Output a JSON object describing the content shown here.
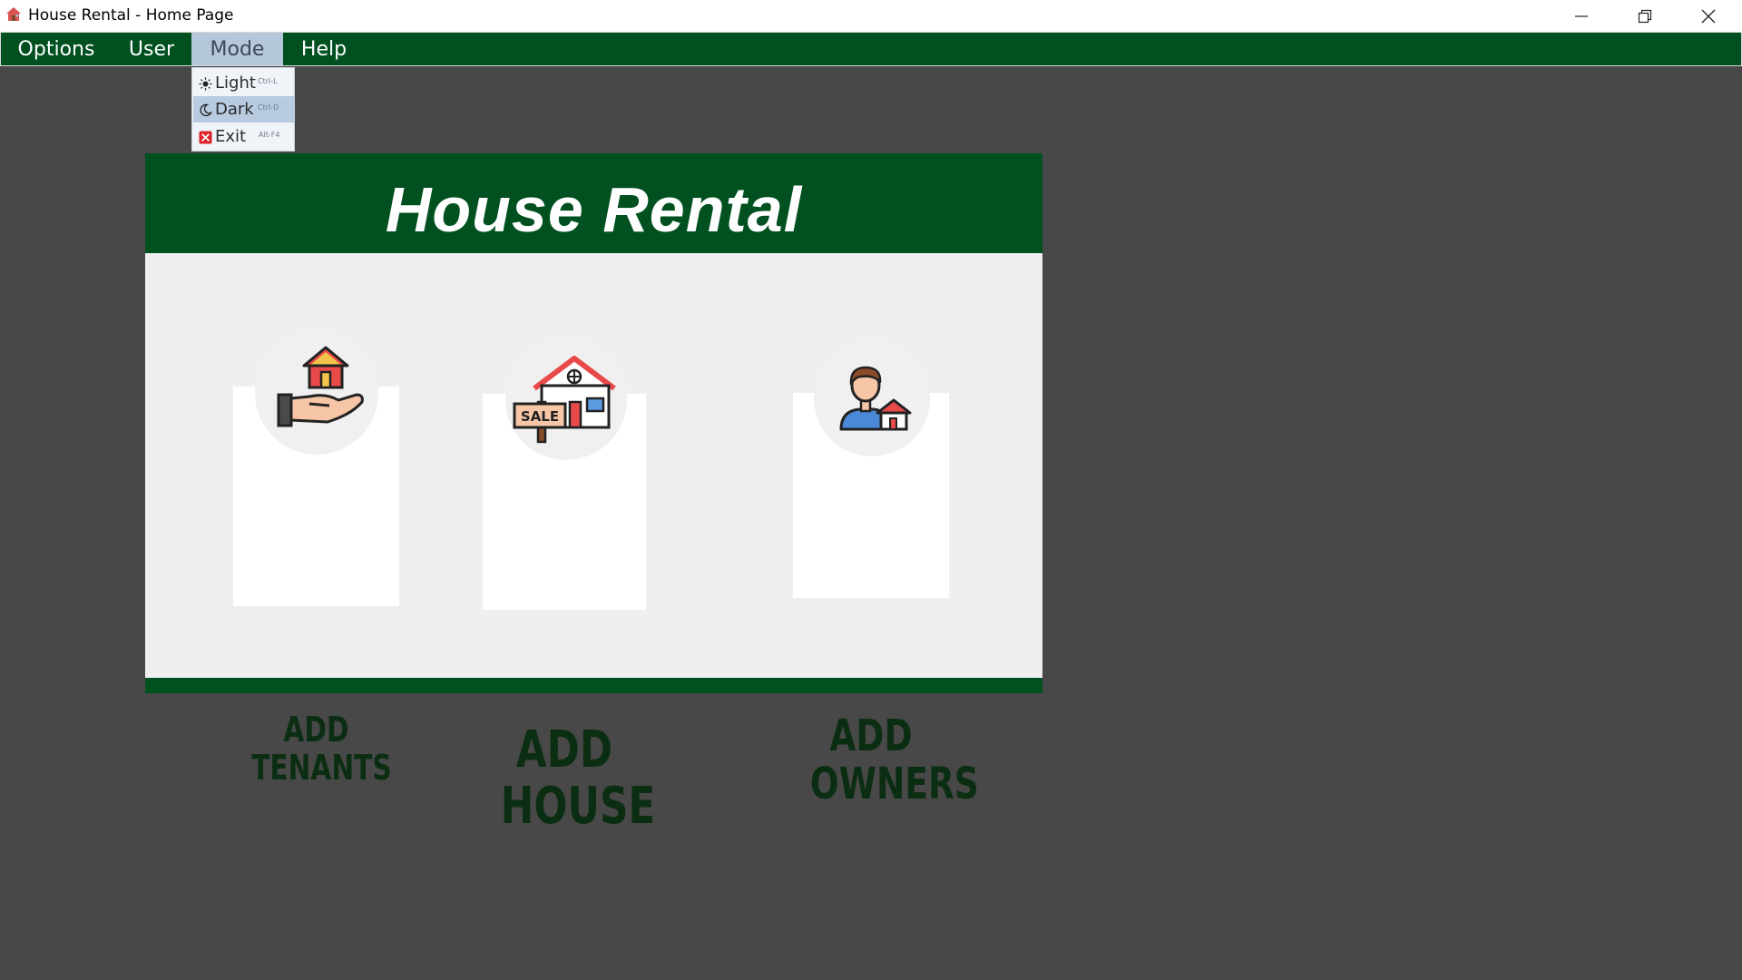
{
  "window": {
    "title": "House Rental - Home Page",
    "icon": "house-app-icon"
  },
  "menubar": {
    "items": [
      {
        "label": "Options"
      },
      {
        "label": "User"
      },
      {
        "label": "Mode",
        "active": true
      },
      {
        "label": "Help"
      }
    ]
  },
  "mode_menu": {
    "items": [
      {
        "label": "Light",
        "shortcut": "Ctrl-L",
        "icon": "sun-icon"
      },
      {
        "label": "Dark",
        "shortcut": "Ctrl-D",
        "icon": "moon-icon",
        "highlighted": true
      },
      {
        "label": "Exit",
        "shortcut": "Alt-F4",
        "icon": "close-red-icon"
      }
    ]
  },
  "main": {
    "title": "House Rental",
    "cards": [
      {
        "line1": "ADD",
        "line2": "TENANTS",
        "icon": "hand-house-icon"
      },
      {
        "line1": "ADD",
        "line2": "HOUSE",
        "icon": "house-sale-icon"
      },
      {
        "line1": "ADD",
        "line2": "OWNERS",
        "icon": "owner-house-icon"
      }
    ]
  },
  "colors": {
    "brand_green": "#005020",
    "background": "#484848",
    "panel": "#efefef",
    "menu_active": "#b5c7da"
  }
}
